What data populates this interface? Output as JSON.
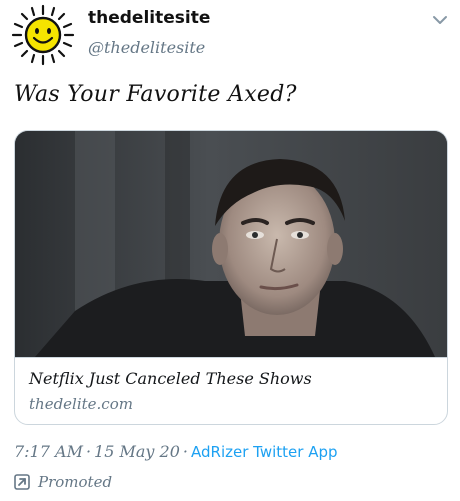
{
  "tweet": {
    "author_name": "thedelitesite",
    "author_handle": "@thedelitesite",
    "text": "Was Your Favorite Axed?",
    "card": {
      "title": "Netflix Just Canceled These Shows",
      "domain": "thedelite.com"
    },
    "time": "7:17 AM",
    "date": "15 May 20",
    "separator": "·",
    "source_app": "AdRizer Twitter App",
    "promoted_label": "Promoted"
  },
  "icons": {
    "avatar": "smiling-sun-icon",
    "menu": "chevron-down-icon",
    "promoted": "promoted-arrow-icon"
  },
  "colors": {
    "link": "#1da1f2",
    "secondary_text": "#657786",
    "card_border": "#ccd6dd",
    "sun_face": "#f5e400"
  }
}
